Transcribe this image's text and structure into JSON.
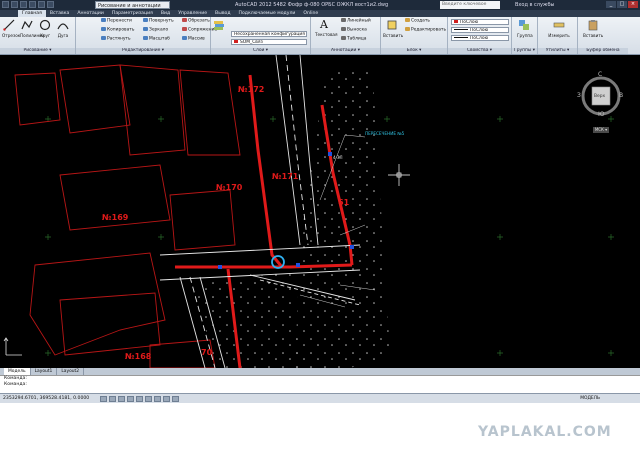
{
  "titlebar": {
    "workspace": "Рисование и аннотации",
    "title": "AutoCAD 2012   5482 Фофр ф-080 ОРБС ОЖКЛ вост1и2.dwg",
    "help_search": "Введите ключевое слово/фразу",
    "sign_in": "Вход в службы",
    "min": "_",
    "max": "□",
    "close": "×"
  },
  "tabs": [
    "Главная",
    "Вставка",
    "Аннотации",
    "Параметризация",
    "Вид",
    "Управление",
    "Вывод",
    "Подключаемые модули",
    "Online"
  ],
  "ribbon": {
    "draw": {
      "title": "Рисование ▾",
      "line": "Отрезок",
      "polyline": "Полилиния",
      "circle": "Круг",
      "arc": "Дуга"
    },
    "modify": {
      "title": "Редактирование ▾",
      "move": "Перенести",
      "rotate": "Повернуть",
      "trim": "Обрезать",
      "copy": "Копировать",
      "mirror": "Зеркало",
      "fillet": "Сопряжение",
      "stretch": "Растянуть",
      "scale": "Масштаб",
      "array": "Массив"
    },
    "layers": {
      "title": "Слои ▾",
      "state": "Несохраненная конфигурация слоев",
      "current": "SOM_Связ"
    },
    "annotation": {
      "title": "Аннотации ▾",
      "text": "Текстовая",
      "linear": "Линейный",
      "leader": "Выноска",
      "table": "Таблица"
    },
    "block": {
      "title": "Блок ▾",
      "insert": "Вставить",
      "create": "Создать",
      "edit": "Редактировать"
    },
    "properties": {
      "title": "Свойства ▾",
      "color": "ПоСлою",
      "linetype": "ПоСлою",
      "lineweight": "ПоСлою"
    },
    "groups": {
      "title": "Группы ▾",
      "group": "Группа"
    },
    "utilities": {
      "title": "Утилиты ▾",
      "measure": "Измерить"
    },
    "clipboard": {
      "title": "Буфер обмена",
      "paste": "Вставить"
    }
  },
  "drawing": {
    "labels": [
      "№172",
      "№171",
      "№170",
      "№169",
      "№168",
      "61",
      "70",
      "4-ЗЛ",
      "ПЕРЕСЕЧЕНИЕ №5"
    ],
    "colors": {
      "background": "#000000",
      "boundary": "#d01818",
      "road": "#ffffff",
      "pipe": "#e01a1a",
      "accent": "#2090d0",
      "hatch": "#c0c0c0",
      "grid": "#2a6a2a"
    }
  },
  "viewcube": {
    "north": "С",
    "south": "Ю",
    "east": "В",
    "west": "З",
    "top": "Верх",
    "wcs": "МСК ▾"
  },
  "layout_tabs": [
    "Модель",
    "Layout1",
    "Layout2"
  ],
  "command": {
    "line1": "Команда:",
    "line2": "Команда:"
  },
  "status": {
    "coords": "2353294.6701, 369528.4181, 0.0000",
    "model": "МОДЕЛЬ"
  },
  "watermark": "YAPLAKAL.COM"
}
